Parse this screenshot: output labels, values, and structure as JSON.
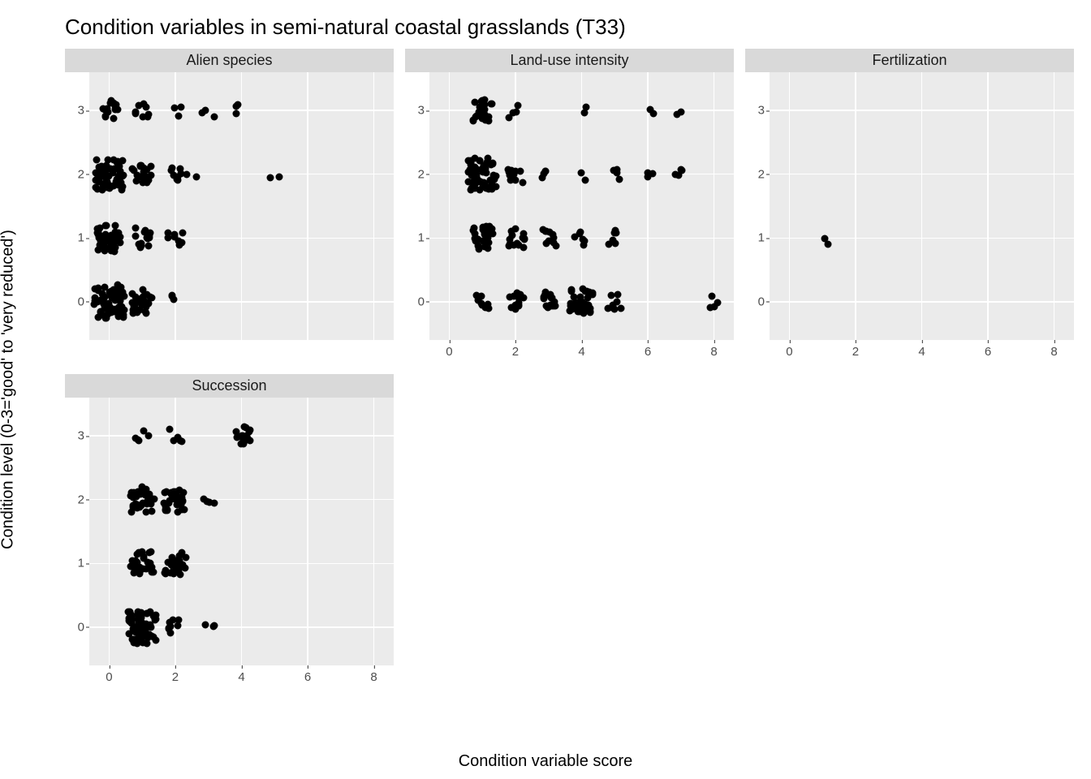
{
  "title": "Condition variables in semi-natural coastal grasslands (T33)",
  "xlabel": "Condition variable score",
  "ylabel": "Condition level (0-3='good' to 'very reduced')",
  "facets": [
    "Alien species",
    "Land-use intensity",
    "Fertilization",
    "Succession"
  ],
  "x_ticks": [
    0,
    2,
    4,
    6,
    8
  ],
  "y_ticks": [
    0,
    1,
    2,
    3
  ],
  "axis": {
    "xmin": -0.6,
    "xmax": 8.6,
    "ymin": -0.6,
    "ymax": 3.6
  },
  "show_xaxis": [
    false,
    true,
    true,
    true
  ],
  "chart_data": [
    {
      "type": "scatter",
      "name": "Alien species",
      "clusters": [
        {
          "x": 0,
          "y": 0,
          "n": 70
        },
        {
          "x": 1,
          "y": 0,
          "n": 25
        },
        {
          "x": 2,
          "y": 0,
          "n": 3
        },
        {
          "x": 0,
          "y": 1,
          "n": 40
        },
        {
          "x": 1,
          "y": 1,
          "n": 15
        },
        {
          "x": 2,
          "y": 1,
          "n": 8
        },
        {
          "x": 0,
          "y": 2,
          "n": 60
        },
        {
          "x": 1,
          "y": 2,
          "n": 20
        },
        {
          "x": 2,
          "y": 2,
          "n": 8
        },
        {
          "x": 2.5,
          "y": 2,
          "n": 2
        },
        {
          "x": 5,
          "y": 2,
          "n": 2
        },
        {
          "x": 0,
          "y": 3,
          "n": 15
        },
        {
          "x": 1,
          "y": 3,
          "n": 8
        },
        {
          "x": 2,
          "y": 3,
          "n": 3
        },
        {
          "x": 3,
          "y": 3,
          "n": 3
        },
        {
          "x": 4,
          "y": 3,
          "n": 3
        }
      ]
    },
    {
      "type": "scatter",
      "name": "Land-use intensity",
      "clusters": [
        {
          "x": 1,
          "y": 0,
          "n": 8
        },
        {
          "x": 2,
          "y": 0,
          "n": 12
        },
        {
          "x": 3,
          "y": 0,
          "n": 15
        },
        {
          "x": 4,
          "y": 0,
          "n": 35
        },
        {
          "x": 5,
          "y": 0,
          "n": 8
        },
        {
          "x": 8,
          "y": 0,
          "n": 4
        },
        {
          "x": 1,
          "y": 1,
          "n": 25
        },
        {
          "x": 2,
          "y": 1,
          "n": 15
        },
        {
          "x": 3,
          "y": 1,
          "n": 10
        },
        {
          "x": 4,
          "y": 1,
          "n": 6
        },
        {
          "x": 5,
          "y": 1,
          "n": 6
        },
        {
          "x": 1,
          "y": 2,
          "n": 60
        },
        {
          "x": 2,
          "y": 2,
          "n": 10
        },
        {
          "x": 3,
          "y": 2,
          "n": 4
        },
        {
          "x": 4,
          "y": 2,
          "n": 2
        },
        {
          "x": 5,
          "y": 2,
          "n": 4
        },
        {
          "x": 6,
          "y": 2,
          "n": 3
        },
        {
          "x": 7,
          "y": 2,
          "n": 4
        },
        {
          "x": 1,
          "y": 3,
          "n": 25
        },
        {
          "x": 2,
          "y": 3,
          "n": 4
        },
        {
          "x": 4,
          "y": 3,
          "n": 2
        },
        {
          "x": 6,
          "y": 3,
          "n": 2
        },
        {
          "x": 7,
          "y": 3,
          "n": 2
        }
      ]
    },
    {
      "type": "scatter",
      "name": "Fertilization",
      "clusters": [
        {
          "x": 1,
          "y": 1,
          "n": 2
        }
      ]
    },
    {
      "type": "scatter",
      "name": "Succession",
      "clusters": [
        {
          "x": 1,
          "y": 0,
          "n": 60
        },
        {
          "x": 2,
          "y": 0,
          "n": 8
        },
        {
          "x": 3,
          "y": 0,
          "n": 3
        },
        {
          "x": 1,
          "y": 1,
          "n": 30
        },
        {
          "x": 2,
          "y": 1,
          "n": 25
        },
        {
          "x": 1,
          "y": 2,
          "n": 35
        },
        {
          "x": 2,
          "y": 2,
          "n": 30
        },
        {
          "x": 3,
          "y": 2,
          "n": 4
        },
        {
          "x": 1,
          "y": 3,
          "n": 5
        },
        {
          "x": 2,
          "y": 3,
          "n": 5
        },
        {
          "x": 4,
          "y": 3,
          "n": 15
        }
      ]
    }
  ]
}
